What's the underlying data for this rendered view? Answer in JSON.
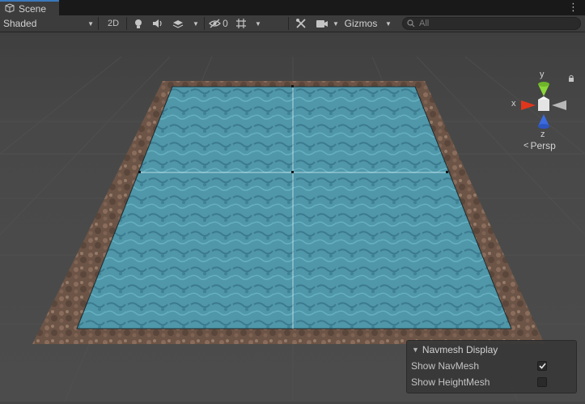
{
  "tab": {
    "label": "Scene",
    "icon": "scene-grid-icon"
  },
  "toolbar": {
    "shading_mode": "Shaded",
    "mode_2d": "2D",
    "lighting_icon": "lightbulb-icon",
    "audio_icon": "speaker-icon",
    "effects_icon": "effects-layers-icon",
    "hidden_objects_icon": "eye-slash-icon",
    "hidden_count": "0",
    "grid_icon": "grid-icon",
    "tools_icon": "tools-icon",
    "camera_icon": "camera-icon",
    "gizmos_label": "Gizmos",
    "search_placeholder": "All"
  },
  "orientation_gizmo": {
    "axis_y": "y",
    "axis_x": "x",
    "axis_z": "z",
    "projection": "Persp"
  },
  "navmesh_overlay": {
    "title": "Navmesh Display",
    "show_navmesh_label": "Show NavMesh",
    "show_navmesh_checked": true,
    "show_heightmesh_label": "Show HeightMesh",
    "show_heightmesh_checked": false
  },
  "colors": {
    "tab_accent": "#3a79bb",
    "navmesh": "#4a97a8",
    "ground_border": "#6f5547",
    "axis_x": "#e0361c",
    "axis_y": "#8bd63a",
    "axis_z": "#3a6be0"
  }
}
